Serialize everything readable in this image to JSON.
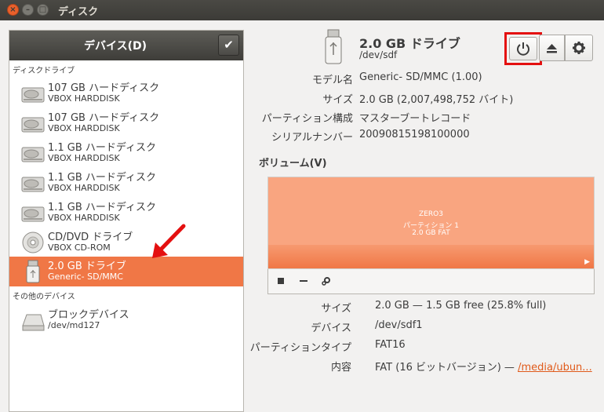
{
  "window": {
    "title": "ディスク"
  },
  "sidebar": {
    "header": "デバイス(D)",
    "sections": {
      "disk_drives": "ディスクドライブ",
      "other_devices": "その他のデバイス"
    },
    "devices": [
      {
        "name": "107 GB ハードディスク",
        "sub": "VBOX HARDDISK",
        "icon": "hard-disk-icon"
      },
      {
        "name": "107 GB ハードディスク",
        "sub": "VBOX HARDDISK",
        "icon": "hard-disk-icon"
      },
      {
        "name": "1.1 GB ハードディスク",
        "sub": "VBOX HARDDISK",
        "icon": "hard-disk-icon"
      },
      {
        "name": "1.1 GB ハードディスク",
        "sub": "VBOX HARDDISK",
        "icon": "hard-disk-icon"
      },
      {
        "name": "1.1 GB ハードディスク",
        "sub": "VBOX HARDDISK",
        "icon": "hard-disk-icon"
      },
      {
        "name": "CD/DVD ドライブ",
        "sub": "VBOX CD-ROM",
        "icon": "optical-disc-icon"
      },
      {
        "name": "2.0 GB ドライブ",
        "sub": "Generic- SD/MMC",
        "icon": "usb-drive-icon",
        "selected": true
      }
    ],
    "other_devices": [
      {
        "name": "ブロックデバイス",
        "sub": "/dev/md127",
        "icon": "block-device-icon"
      }
    ]
  },
  "drive": {
    "title": "2.0 GB ドライブ",
    "path": "/dev/sdf",
    "properties": [
      {
        "label": "モデル名",
        "value": "Generic- SD/MMC (1.00)"
      },
      {
        "label": "サイズ",
        "value": "2.0 GB (2,007,498,752 バイト)"
      },
      {
        "label": "パーティション構成",
        "value": "マスターブートレコード"
      },
      {
        "label": "シリアルナンバー",
        "value": "20090815198100000"
      }
    ]
  },
  "volumes": {
    "title": "ボリューム(V)",
    "partition": {
      "label": "ZERO3",
      "name": "パーティション 1",
      "size": "2.0 GB FAT"
    },
    "details": {
      "size_label": "サイズ",
      "size_value": "2.0 GB — 1.5 GB free (25.8% full)",
      "device_label": "デバイス",
      "device_value": "/dev/sdf1",
      "type_label": "パーティションタイプ",
      "type_value": "FAT16",
      "contents_label": "内容",
      "contents_prefix": "FAT (16 ビットバージョン) — ",
      "contents_link": "/media/ubun..."
    }
  },
  "colors": {
    "accent": "#f07746",
    "highlight_box": "#e41010",
    "partition": "#f9a580"
  }
}
